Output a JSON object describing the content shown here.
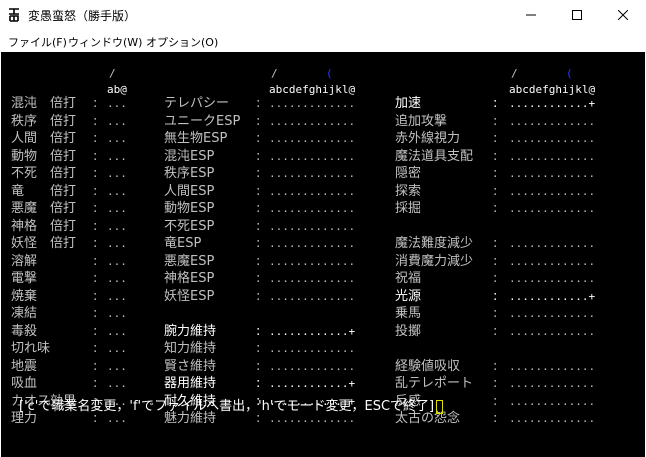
{
  "window": {
    "title": "変愚蛮怒（勝手版）",
    "icon": "app-kanji-icon",
    "controls": [
      "minimize-icon",
      "maximize-icon",
      "close-icon"
    ]
  },
  "menu": [
    "ファイル(F)",
    "ウィンドウ(W)",
    "オプション(O)"
  ],
  "colors": {
    "text": "#c0c0c0",
    "highlight": "#ffffff",
    "accent": "#2040ff",
    "background": "#000000",
    "cursor": "#e0e000"
  },
  "columns": [
    {
      "slash": "/",
      "header": "ab@",
      "rows": [
        {
          "label": "混沌　倍打",
          "sep": ":",
          "value": "...",
          "hl": false
        },
        {
          "label": "秩序　倍打",
          "sep": ":",
          "value": "...",
          "hl": false
        },
        {
          "label": "人間　倍打",
          "sep": ":",
          "value": "...",
          "hl": false
        },
        {
          "label": "動物　倍打",
          "sep": ":",
          "value": "...",
          "hl": false
        },
        {
          "label": "不死　倍打",
          "sep": ":",
          "value": "...",
          "hl": false
        },
        {
          "label": "竜　　倍打",
          "sep": ":",
          "value": "...",
          "hl": false
        },
        {
          "label": "悪魔　倍打",
          "sep": ":",
          "value": "...",
          "hl": false
        },
        {
          "label": "神格　倍打",
          "sep": ":",
          "value": "...",
          "hl": false
        },
        {
          "label": "妖怪　倍打",
          "sep": ":",
          "value": "...",
          "hl": false
        },
        {
          "label": "溶解",
          "sep": ":",
          "value": "...",
          "hl": false
        },
        {
          "label": "電撃",
          "sep": ":",
          "value": "...",
          "hl": false
        },
        {
          "label": "焼棄",
          "sep": ":",
          "value": "...",
          "hl": false
        },
        {
          "label": "凍結",
          "sep": ":",
          "value": "...",
          "hl": false
        },
        {
          "label": "毒殺",
          "sep": ":",
          "value": "...",
          "hl": false
        },
        {
          "label": "切れ味",
          "sep": ":",
          "value": "...",
          "hl": false
        },
        {
          "label": "地震",
          "sep": ":",
          "value": "...",
          "hl": false
        },
        {
          "label": "吸血",
          "sep": ":",
          "value": "...",
          "hl": false
        },
        {
          "label": "カオス効果",
          "sep": ":",
          "value": "...",
          "hl": false
        },
        {
          "label": "理力",
          "sep": ":",
          "value": "...",
          "hl": false
        }
      ]
    },
    {
      "slash": "/",
      "header": "abcdefghijkl@",
      "accent": "(",
      "rows": [
        {
          "label": "テレパシー",
          "sep": ":",
          "value": ".............",
          "hl": false
        },
        {
          "label": "ユニークESP",
          "sep": ":",
          "value": ".............",
          "hl": false
        },
        {
          "label": "無生物ESP",
          "sep": ":",
          "value": ".............",
          "hl": false
        },
        {
          "label": "混沌ESP",
          "sep": ":",
          "value": ".............",
          "hl": false
        },
        {
          "label": "秩序ESP",
          "sep": ":",
          "value": ".............",
          "hl": false
        },
        {
          "label": "人間ESP",
          "sep": ":",
          "value": ".............",
          "hl": false
        },
        {
          "label": "動物ESP",
          "sep": ":",
          "value": ".............",
          "hl": false
        },
        {
          "label": "不死ESP",
          "sep": ":",
          "value": ".............",
          "hl": false
        },
        {
          "label": "竜ESP",
          "sep": ":",
          "value": ".............",
          "hl": false
        },
        {
          "label": "悪魔ESP",
          "sep": ":",
          "value": ".............",
          "hl": false
        },
        {
          "label": "神格ESP",
          "sep": ":",
          "value": ".............",
          "hl": false
        },
        {
          "label": "妖怪ESP",
          "sep": ":",
          "value": ".............",
          "hl": false
        },
        {
          "label": "",
          "sep": "",
          "value": "",
          "hl": false
        },
        {
          "label": "腕力維持",
          "sep": ":",
          "value": "............+",
          "hl": true
        },
        {
          "label": "知力維持",
          "sep": ":",
          "value": ".............",
          "hl": false
        },
        {
          "label": "賢さ維持",
          "sep": ":",
          "value": ".............",
          "hl": false
        },
        {
          "label": "器用維持",
          "sep": ":",
          "value": "............+",
          "hl": true
        },
        {
          "label": "耐久維持",
          "sep": ":",
          "value": "............+",
          "hl": true
        },
        {
          "label": "魅力維持",
          "sep": ":",
          "value": ".............",
          "hl": false
        }
      ]
    },
    {
      "slash": "/",
      "header": "abcdefghijkl@",
      "accent": "(",
      "rows": [
        {
          "label": "加速",
          "sep": ":",
          "value": "............+",
          "hl": true
        },
        {
          "label": "追加攻撃",
          "sep": ":",
          "value": ".............",
          "hl": false
        },
        {
          "label": "赤外線視力",
          "sep": ":",
          "value": ".............",
          "hl": false
        },
        {
          "label": "魔法道具支配",
          "sep": ":",
          "value": ".............",
          "hl": false
        },
        {
          "label": "隠密",
          "sep": ":",
          "value": ".............",
          "hl": false
        },
        {
          "label": "探索",
          "sep": ":",
          "value": ".............",
          "hl": false
        },
        {
          "label": "採掘",
          "sep": ":",
          "value": ".............",
          "hl": false
        },
        {
          "label": "",
          "sep": "",
          "value": "",
          "hl": false
        },
        {
          "label": "魔法難度減少",
          "sep": ":",
          "value": ".............",
          "hl": false
        },
        {
          "label": "消費魔力減少",
          "sep": ":",
          "value": ".............",
          "hl": false
        },
        {
          "label": "祝福",
          "sep": ":",
          "value": ".............",
          "hl": false
        },
        {
          "label": "光源",
          "sep": ":",
          "value": "............+",
          "hl": true
        },
        {
          "label": "乗馬",
          "sep": ":",
          "value": ".............",
          "hl": false
        },
        {
          "label": "投擲",
          "sep": ":",
          "value": ".............",
          "hl": false
        },
        {
          "label": "",
          "sep": "",
          "value": "",
          "hl": false
        },
        {
          "label": "経験値吸収",
          "sep": ":",
          "value": ".............",
          "hl": false
        },
        {
          "label": "乱テレポート",
          "sep": ":",
          "value": ".............",
          "hl": false
        },
        {
          "label": "反感",
          "sep": ":",
          "value": ".............",
          "hl": false
        },
        {
          "label": "太古の怨念",
          "sep": ":",
          "value": ".............",
          "hl": false
        }
      ]
    }
  ],
  "prompt": "['c'で職業名変更，'f'でファイルへ書出，'h'でモード変更，ESCで終了]"
}
